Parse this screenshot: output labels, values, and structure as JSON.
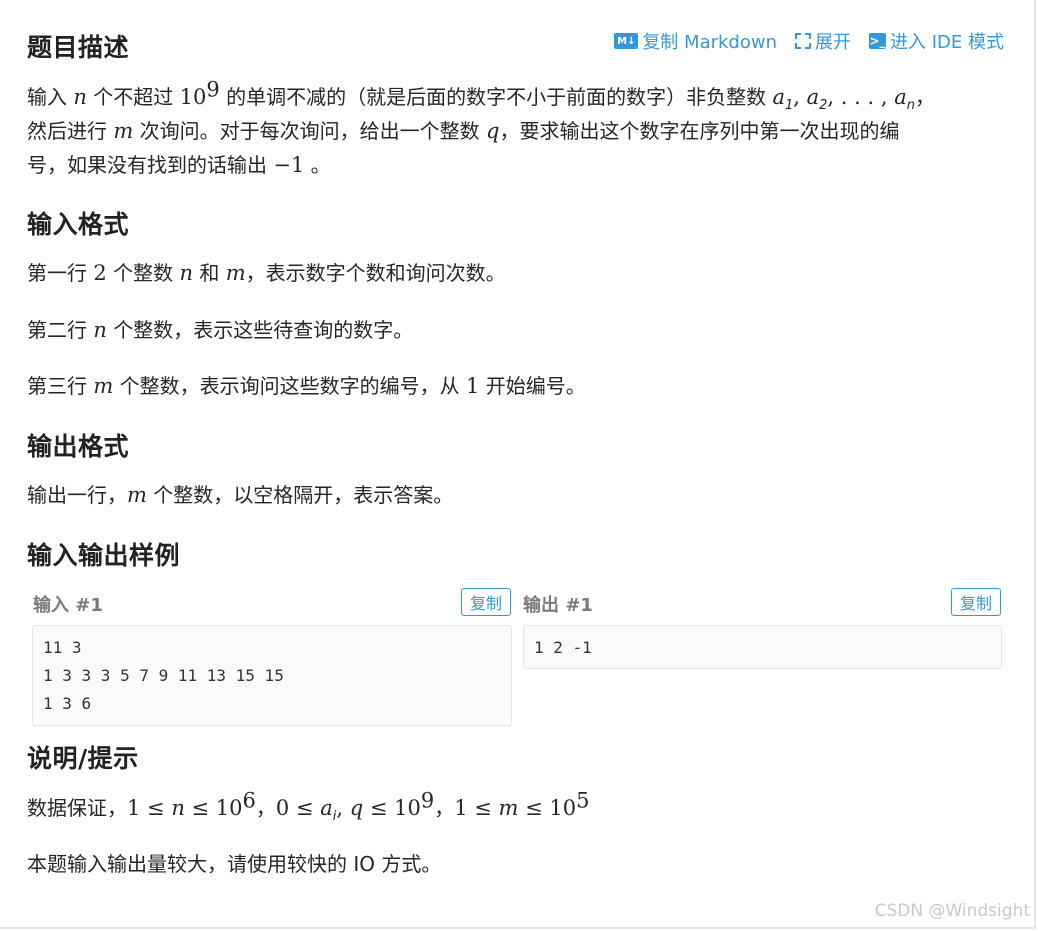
{
  "header": {
    "title": "题目描述",
    "links": {
      "md_icon": "M↓",
      "copy_markdown": "复制 Markdown",
      "expand": "展开",
      "term_icon": ">_",
      "ide_mode": "进入 IDE 模式"
    }
  },
  "description": {
    "l1_a": "输入 ",
    "var_n": "n",
    "l1_b": " 个不超过 ",
    "pow_base": "10",
    "pow_exp": "9",
    "l1_c": " 的单调不减的（就是后面的数字不小于前面的数字）非负整数 ",
    "seq": {
      "a": "a",
      "s1": "1",
      "s2": "2",
      "sn": "n",
      "sep": ", ",
      "dots": ", . . . , "
    },
    "l1_end": "，",
    "l2_a": "然后进行 ",
    "var_m": "m",
    "l2_b": " 次询问。对于每次询问，给出一个整数 ",
    "var_q": "q",
    "l2_c": "，要求输出这个数字在序列中第一次出现的编",
    "l3_a": "号，如果没有找到的话输出 ",
    "neg_one": "−1",
    "l3_b": " 。"
  },
  "input_format": {
    "title": "输入格式",
    "p1_a": "第一行 ",
    "p1_num": "2",
    "p1_b": " 个整数 ",
    "p1_n": "n",
    "p1_c": " 和 ",
    "p1_m": "m",
    "p1_d": "，表示数字个数和询问次数。",
    "p2_a": "第二行 ",
    "p2_n": "n",
    "p2_b": " 个整数，表示这些待查询的数字。",
    "p3_a": "第三行 ",
    "p3_m": "m",
    "p3_b": " 个整数，表示询问这些数字的编号，从 ",
    "p3_num": "1",
    "p3_c": " 开始编号。"
  },
  "output_format": {
    "title": "输出格式",
    "p_a": "输出一行，",
    "p_m": "m",
    "p_b": " 个整数，以空格隔开，表示答案。"
  },
  "samples": {
    "title": "输入输出样例",
    "input_label": "输入 #1",
    "output_label": "输出 #1",
    "copy_label": "复制",
    "input_lines": [
      "11 3",
      "1 3 3 3 5 7 9 11 13 15 15",
      "1 3 6"
    ],
    "output_lines": [
      "1 2 -1"
    ]
  },
  "hint": {
    "title": "说明/提示",
    "p1_a": "数据保证，",
    "c1": "1 ≤ ",
    "c1_var": "n",
    "c1_b": " ≤ 10",
    "c1_exp": "6",
    "sep": "，",
    "c2": "0 ≤ ",
    "c2_a": "a",
    "c2_i": "i",
    "c2_b": ", ",
    "c2_q": "q",
    "c2_c": " ≤ 10",
    "c2_exp": "9",
    "c3": "1 ≤ ",
    "c3_var": "m",
    "c3_b": " ≤ 10",
    "c3_exp": "5",
    "p2": "本题输入输出量较大，请使用较快的 IO 方式。"
  },
  "watermark": "CSDN @Windsight",
  "colors": {
    "accent": "#3498db",
    "text": "#262626",
    "muted": "#7a7a7a",
    "code_bg": "#fafafa"
  }
}
